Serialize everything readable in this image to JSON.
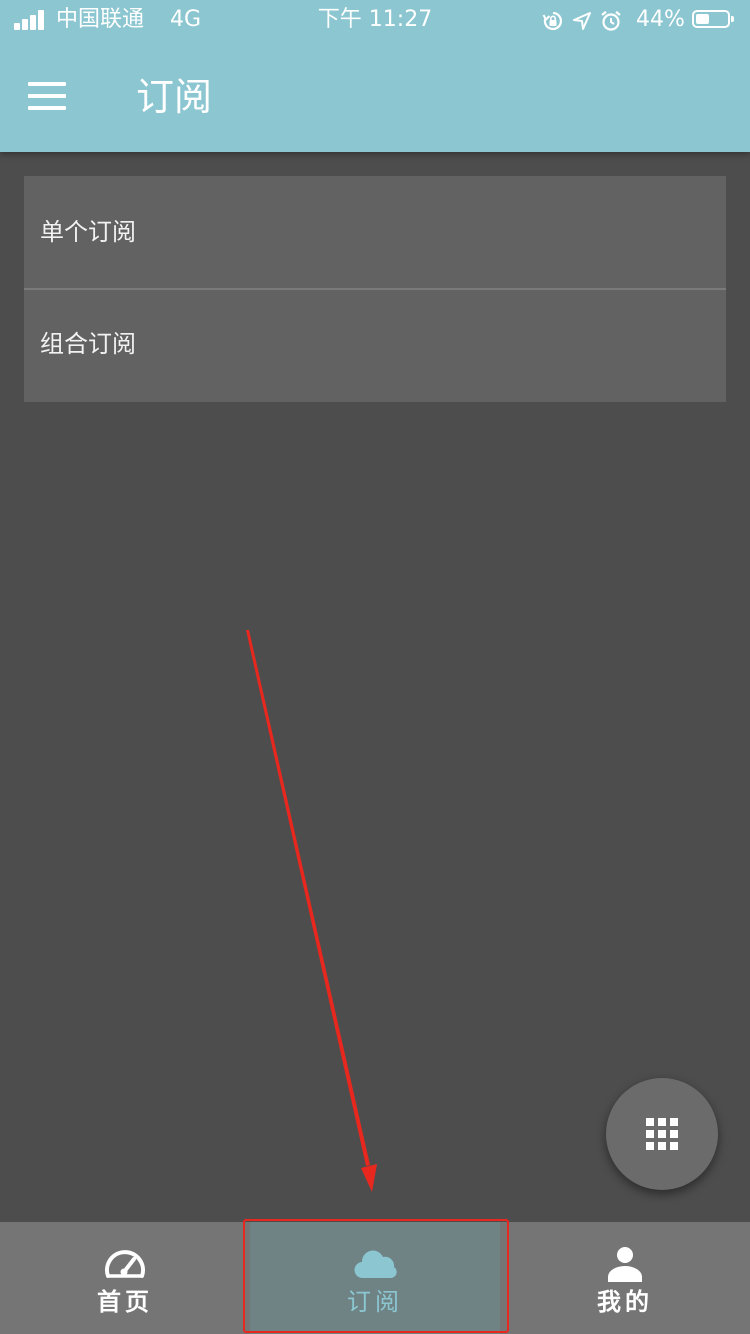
{
  "status_bar": {
    "carrier": "中国联通",
    "network": "4G",
    "time": "下午 11:27",
    "battery_percent": "44%",
    "battery_level": 0.44,
    "icons": [
      "orientation-lock-icon",
      "location-arrow-icon",
      "alarm-icon"
    ]
  },
  "header": {
    "title": "订阅",
    "menu_icon": "hamburger-menu-icon"
  },
  "list": {
    "items": [
      {
        "label": "单个订阅"
      },
      {
        "label": "组合订阅"
      }
    ]
  },
  "fab": {
    "icon": "grid-icon"
  },
  "bottom_nav": {
    "items": [
      {
        "label": "首页",
        "icon": "speedometer-icon",
        "active": false
      },
      {
        "label": "订阅",
        "icon": "cloud-icon",
        "active": true
      },
      {
        "label": "我的",
        "icon": "user-icon",
        "active": false
      }
    ]
  },
  "annotation": {
    "type": "arrow-and-box",
    "target": "bottom-nav-subscribe",
    "color": "#e8281e"
  },
  "colors": {
    "accent": "#8bc6d1",
    "background": "#4d4d4d",
    "card": "#626262",
    "nav_bar": "#757575",
    "annotation": "#e8281e"
  }
}
